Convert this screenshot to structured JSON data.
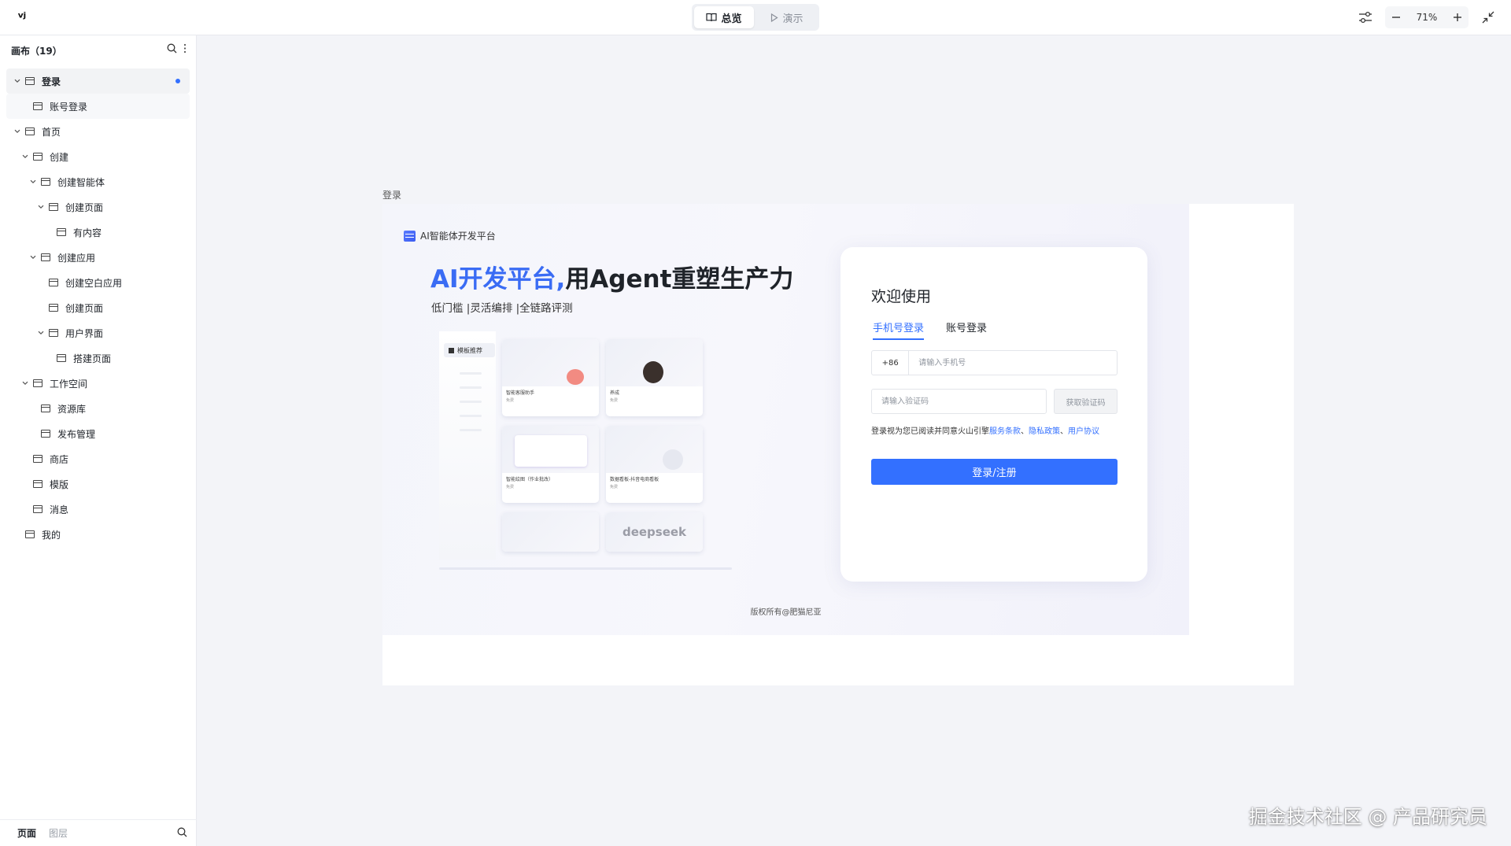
{
  "topbar": {
    "logo": "ᵛʲ",
    "mode_overview": "总览",
    "mode_present": "演示",
    "zoom": "71%"
  },
  "sidebar": {
    "title": "画布（19）",
    "items": [
      {
        "label": "登录",
        "level": 1,
        "expanded": true,
        "selected": true
      },
      {
        "label": "账号登录",
        "level": 2
      },
      {
        "label": "首页",
        "level": 1,
        "expanded": true
      },
      {
        "label": "创建",
        "level": 2,
        "expanded": true
      },
      {
        "label": "创建智能体",
        "level": 3,
        "expanded": true
      },
      {
        "label": "创建页面",
        "level": 4,
        "expanded": true
      },
      {
        "label": "有内容",
        "level": 5
      },
      {
        "label": "创建应用",
        "level": 3,
        "expanded": true
      },
      {
        "label": "创建空白应用",
        "level": 4
      },
      {
        "label": "创建页面",
        "level": 4
      },
      {
        "label": "用户界面",
        "level": 4,
        "expanded": true
      },
      {
        "label": "搭建页面",
        "level": 5
      },
      {
        "label": "工作空间",
        "level": 2,
        "expanded": true
      },
      {
        "label": "资源库",
        "level": 3
      },
      {
        "label": "发布管理",
        "level": 3
      },
      {
        "label": "商店",
        "level": 2
      },
      {
        "label": "模版",
        "level": 2
      },
      {
        "label": "消息",
        "level": 2
      },
      {
        "label": "我的",
        "level": 1
      }
    ],
    "footer_pages": "页面",
    "footer_layers": "图层"
  },
  "canvas": {
    "frame_label": "登录",
    "brand": "AI智能体开发平台",
    "hero_blue": "AI开发平台,",
    "hero_rest": "用Agent重塑生产力",
    "hero_sub": "低门槛  |灵活编排   |全链路评测",
    "preview": {
      "tab": "模板推荐",
      "cards": [
        {
          "title": "智能客服助手",
          "meta": "免费"
        },
        {
          "title": "养成",
          "meta": "免费"
        },
        {
          "title": "智能绘图（作业批改）",
          "meta": "免费"
        },
        {
          "title": "数据看板-抖音电商看板",
          "meta": "免费"
        },
        {
          "title": "",
          "meta": ""
        },
        {
          "title": "deepseek",
          "meta": ""
        }
      ]
    },
    "copyright": "版权所有@肥猫尼亚",
    "login": {
      "welcome": "欢迎使用",
      "tab_phone": "手机号登录",
      "tab_account": "账号登录",
      "country_code": "+86",
      "phone_placeholder": "请输入手机号",
      "code_placeholder": "请输入验证码",
      "get_code": "获取验证码",
      "agree_prefix": "登录视为您已阅读并同意火山引擎",
      "terms": "服务条款",
      "privacy": "隐私政策",
      "user_agreement": "用户协议",
      "submit": "登录/注册"
    }
  },
  "watermark": "掘金技术社区 @ 产品研究员"
}
